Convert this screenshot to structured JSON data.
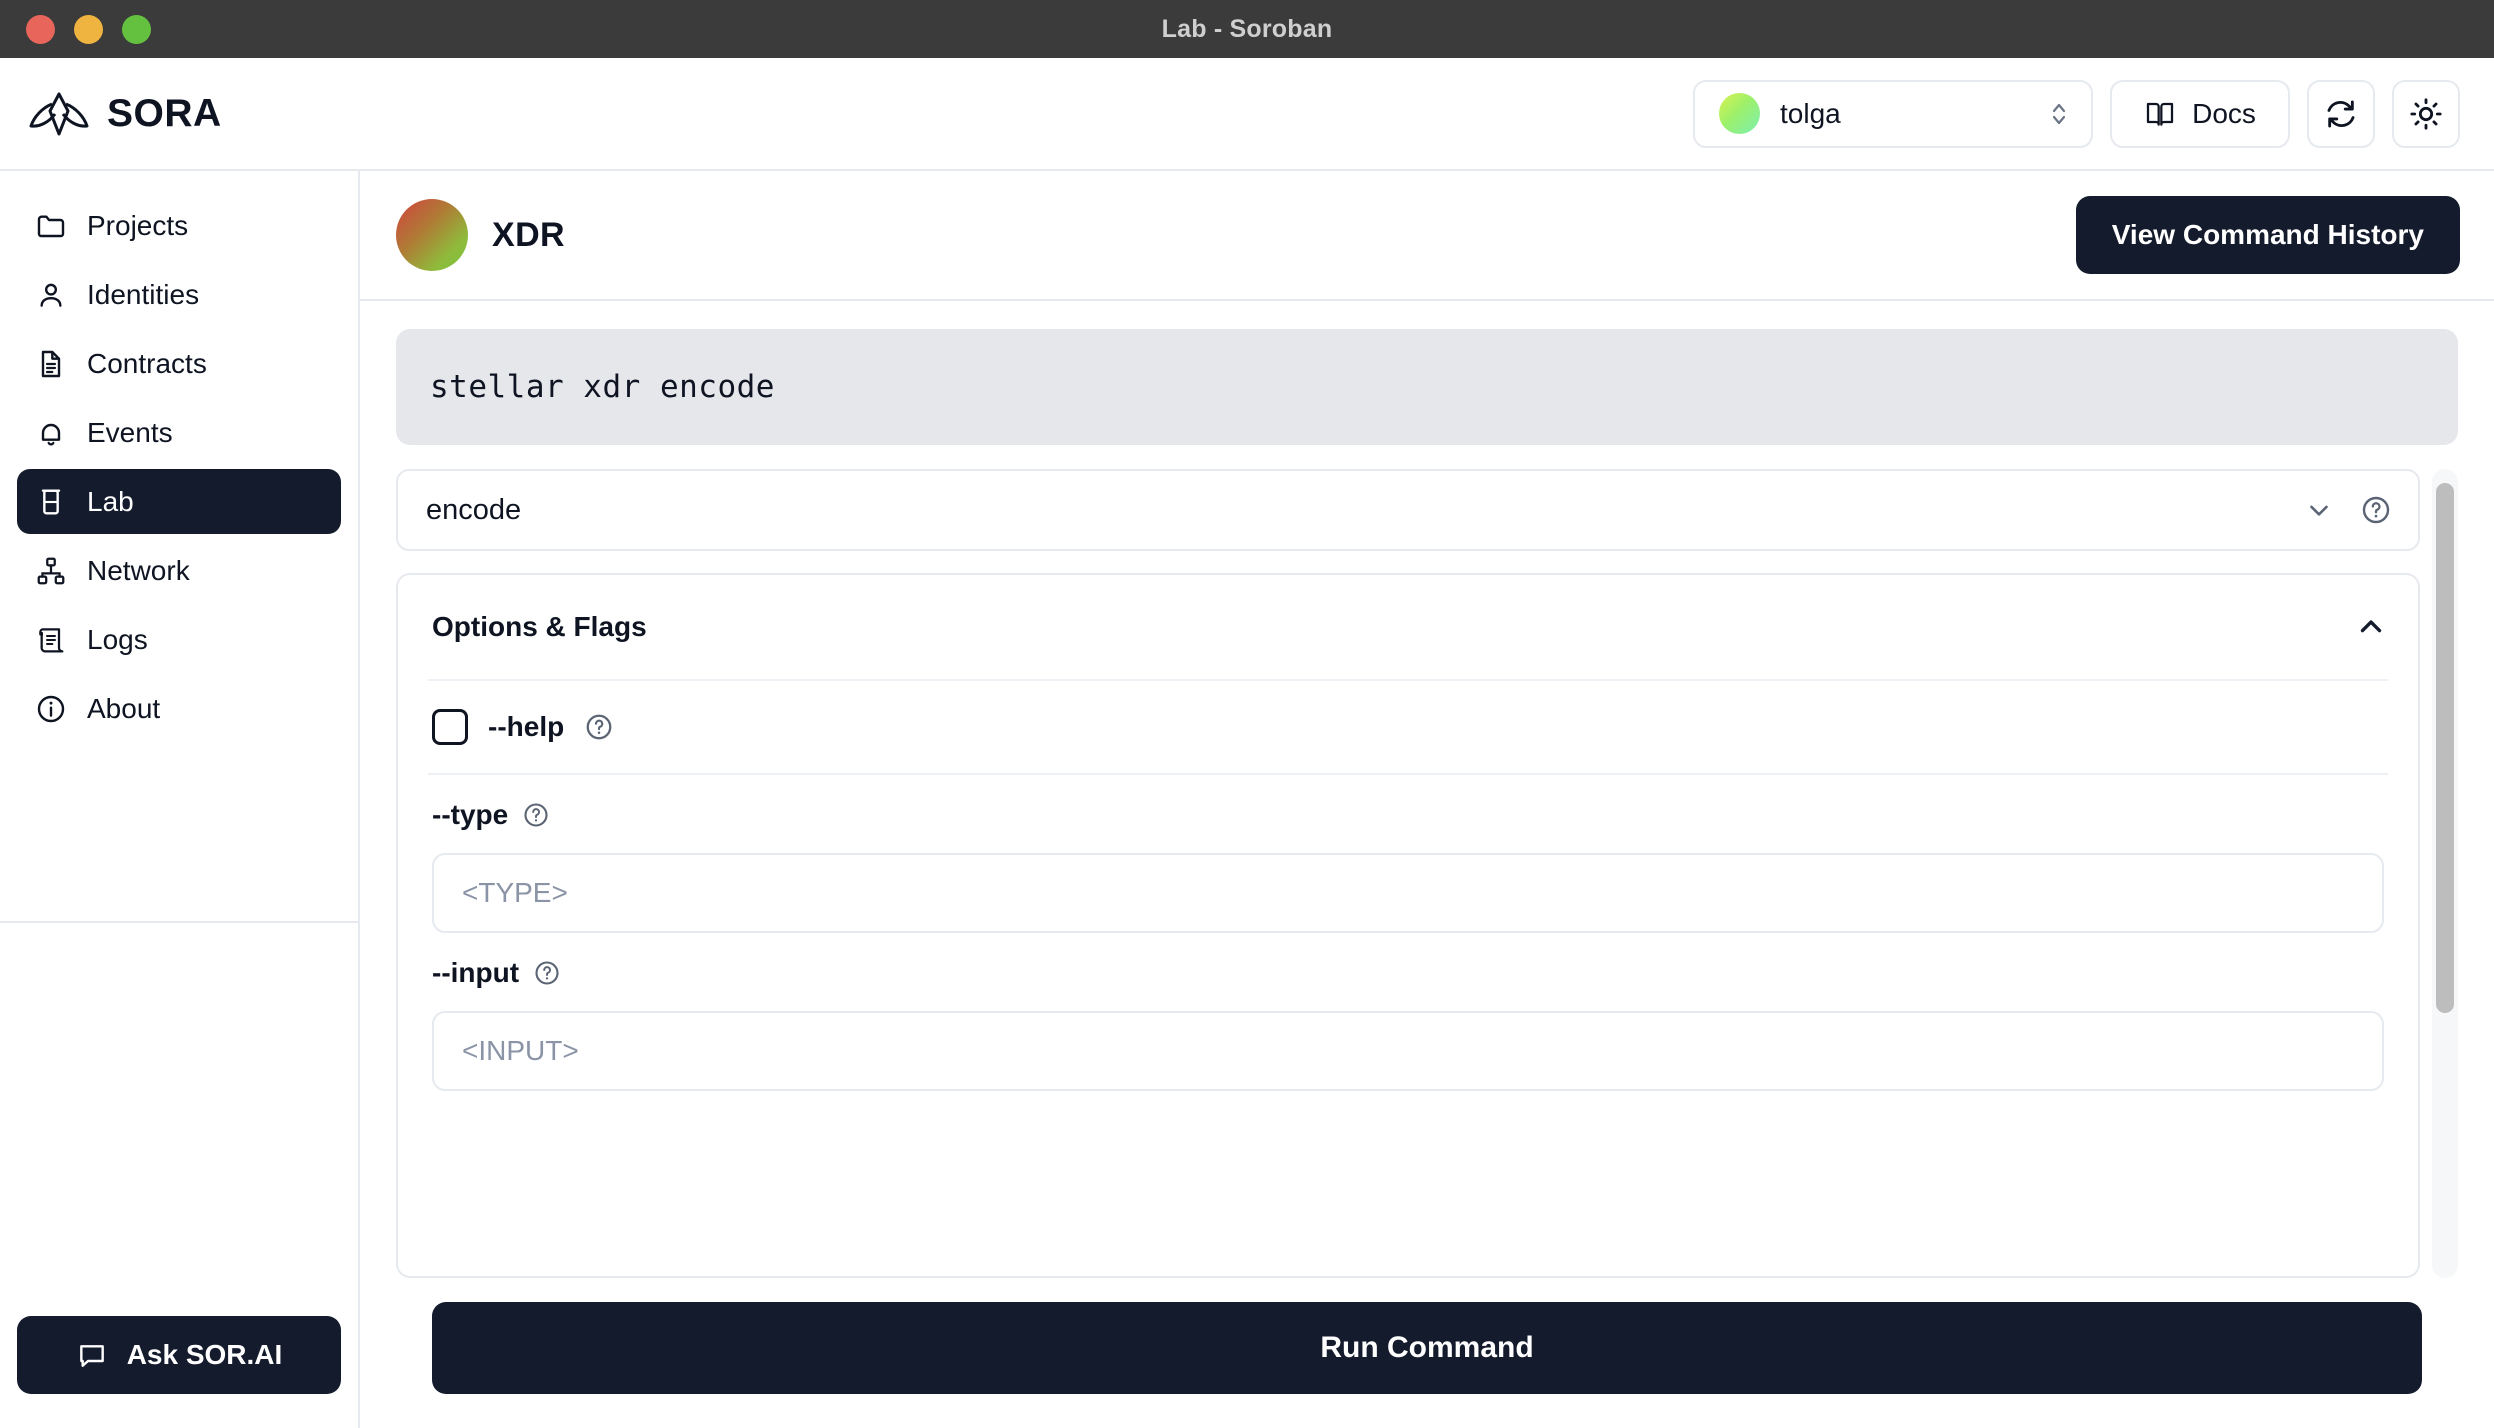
{
  "window": {
    "title": "Lab - Soroban",
    "traffic_lights": [
      "close",
      "minimize",
      "zoom"
    ]
  },
  "header": {
    "brand": "SORA",
    "brand_logo_icon": "sora-mountain-logo",
    "account": {
      "name": "tolga",
      "avatar_icon": "account-avatar",
      "chevron_icon": "up-down-chevron-icon"
    },
    "docs": {
      "label": "Docs",
      "icon": "book-icon"
    },
    "refresh": {
      "icon": "refresh-icon"
    },
    "theme": {
      "icon": "sun-icon"
    }
  },
  "sidebar": {
    "items": [
      {
        "label": "Projects",
        "icon": "folder-icon",
        "active": false
      },
      {
        "label": "Identities",
        "icon": "user-icon",
        "active": false
      },
      {
        "label": "Contracts",
        "icon": "document-icon",
        "active": false
      },
      {
        "label": "Events",
        "icon": "bell-icon",
        "active": false
      },
      {
        "label": "Lab",
        "icon": "flask-icon",
        "active": true
      },
      {
        "label": "Network",
        "icon": "network-icon",
        "active": false
      },
      {
        "label": "Logs",
        "icon": "scroll-icon",
        "active": false
      },
      {
        "label": "About",
        "icon": "info-circle-icon",
        "active": false
      }
    ],
    "ask_button": {
      "label": "Ask SOR.AI",
      "icon": "chat-bubble-icon"
    }
  },
  "page": {
    "title": "XDR",
    "avatar_icon": "xdr-gradient-avatar",
    "history_button": "View Command History",
    "command_preview": "stellar xdr encode",
    "subcommand": {
      "value": "encode",
      "chevron_icon": "chevron-down-icon",
      "help_icon": "question-circle-icon"
    },
    "options_section": {
      "title": "Options & Flags",
      "collapse_icon": "chevron-up-icon",
      "checkbox_flags": [
        {
          "label": "--help",
          "checked": false,
          "help_icon": "question-circle-icon"
        }
      ],
      "fields": [
        {
          "label": "--type",
          "placeholder": "<TYPE>",
          "value": "",
          "help_icon": "question-circle-icon"
        },
        {
          "label": "--input",
          "placeholder": "<INPUT>",
          "value": "",
          "help_icon": "question-circle-icon"
        }
      ]
    },
    "run_button": "Run Command"
  },
  "colors": {
    "dark": "#141b2d",
    "border": "#e6eaef",
    "code_bg": "#e5e7eb",
    "placeholder": "#8a94a6",
    "titlebar": "#3b3b3b"
  }
}
